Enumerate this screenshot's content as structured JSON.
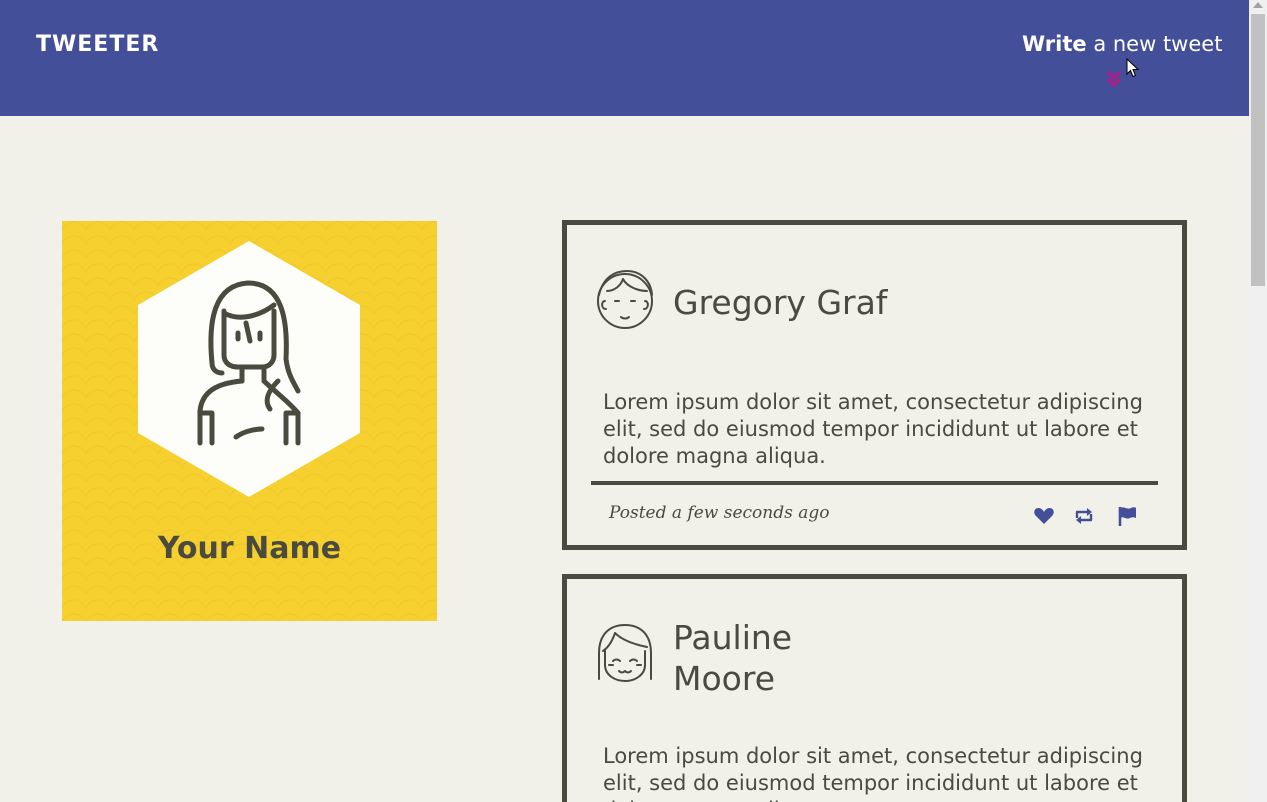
{
  "nav": {
    "logo": "TWEETER",
    "compose_bold": "Write",
    "compose_rest": " a new tweet",
    "compose_icon": "chevron-double-down-icon",
    "bg_color": "#434f98",
    "chevron_color": "#b5198c"
  },
  "profile": {
    "name": "Your Name",
    "bg_color": "#f6d02f",
    "avatar_icon": "woman-avatar-icon"
  },
  "tweets": [
    {
      "author": "Gregory Graf",
      "avatar_icon": "man-avatar-icon",
      "content": "Lorem ipsum dolor sit amet, consectetur adipiscing elit, sed do eiusmod tempor incididunt ut labore et dolore magna aliqua.",
      "timestamp": "Posted a few seconds ago",
      "actions": [
        "heart-icon",
        "retweet-icon",
        "flag-icon"
      ]
    },
    {
      "author": "Pauline Moore",
      "avatar_icon": "girl-avatar-icon",
      "content": "Lorem ipsum dolor sit amet, consectetur adipiscing elit, sed do eiusmod tempor incididunt ut labore et dolore magna aliqua."
    }
  ],
  "colors": {
    "page_bg": "#f1f0e9",
    "text": "#4b4a3f",
    "action_icon": "#434f98"
  }
}
